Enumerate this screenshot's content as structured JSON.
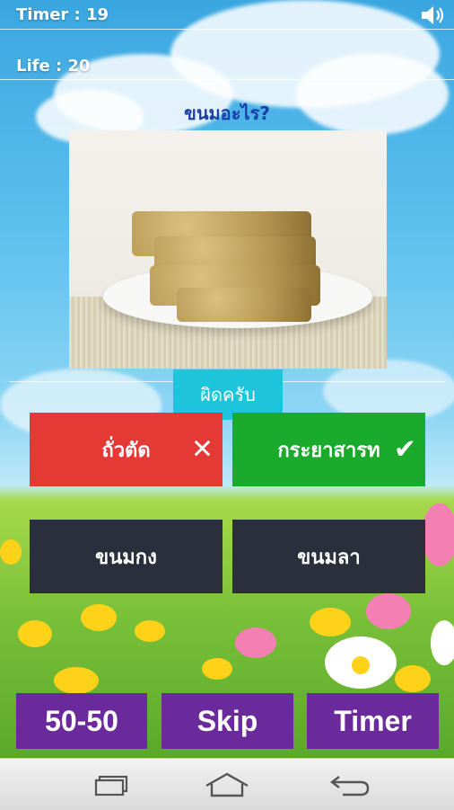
{
  "hud": {
    "timer_label": "Timer  : 19",
    "life_label": "Life : 20",
    "sound_icon": "speaker-icon"
  },
  "question": {
    "text": "ขนมอะไร?"
  },
  "feedback": {
    "text": "ผิดครับ"
  },
  "answers": [
    {
      "label": "ถั่วตัด",
      "state": "wrong",
      "color": "#e53935",
      "icon": "close-icon"
    },
    {
      "label": "กระยาสารท",
      "state": "correct",
      "color": "#1aaa2c",
      "icon": "check-icon"
    },
    {
      "label": "ขนมกง",
      "state": "neutral",
      "color": "#2b2e3b"
    },
    {
      "label": "ขนมลา",
      "state": "neutral",
      "color": "#2b2e3b"
    }
  ],
  "powerups": [
    {
      "label": "50-50"
    },
    {
      "label": "Skip"
    },
    {
      "label": "Timer"
    }
  ],
  "navbar": {
    "icons": [
      "recent-apps-icon",
      "home-icon",
      "back-icon"
    ]
  },
  "colors": {
    "wrong": "#e53935",
    "correct": "#1aaa2c",
    "neutral": "#2b2e3b",
    "powerup": "#6b2a9c",
    "badge": "#1ec4dc"
  }
}
